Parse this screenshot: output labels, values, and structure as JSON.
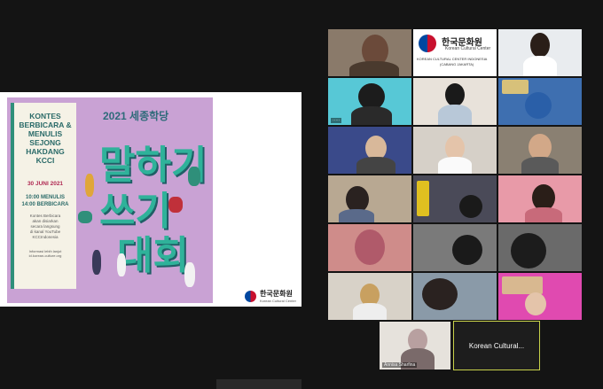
{
  "poster": {
    "title_lines": [
      "KONTES",
      "BERBICARA &",
      "MENULIS",
      "SEJONG",
      "HAKDANG",
      "KCCI"
    ],
    "date": "30 JUNI 2021",
    "schedule": [
      "10:00 MENULIS",
      "14:00 BERBICARA"
    ],
    "desc": [
      "Kontes Berbicara",
      "akan disiarkan",
      "secara langsung",
      "di kanal YouTube",
      "KCCIndonesia"
    ],
    "info": [
      "Informasi lebih lanjut",
      "id.korean-culture.org"
    ],
    "year_title": "2021 세종학당",
    "big_line1": "말하기",
    "big_line2": "쓰기",
    "big_line3": "대회"
  },
  "brand": {
    "korean": "한국문화원",
    "english": "Korean Cultural Center"
  },
  "banner": {
    "korean": "한국문화원",
    "english": "Korean Cultural Center",
    "sub1": "KOREAN CULTURAL CENTER INDONESIA",
    "sub2": "(CABANG JAKARTA)"
  },
  "participants": [
    {
      "name": "Annisa Sharfina"
    },
    {
      "name": "Korean Cultural..."
    }
  ]
}
